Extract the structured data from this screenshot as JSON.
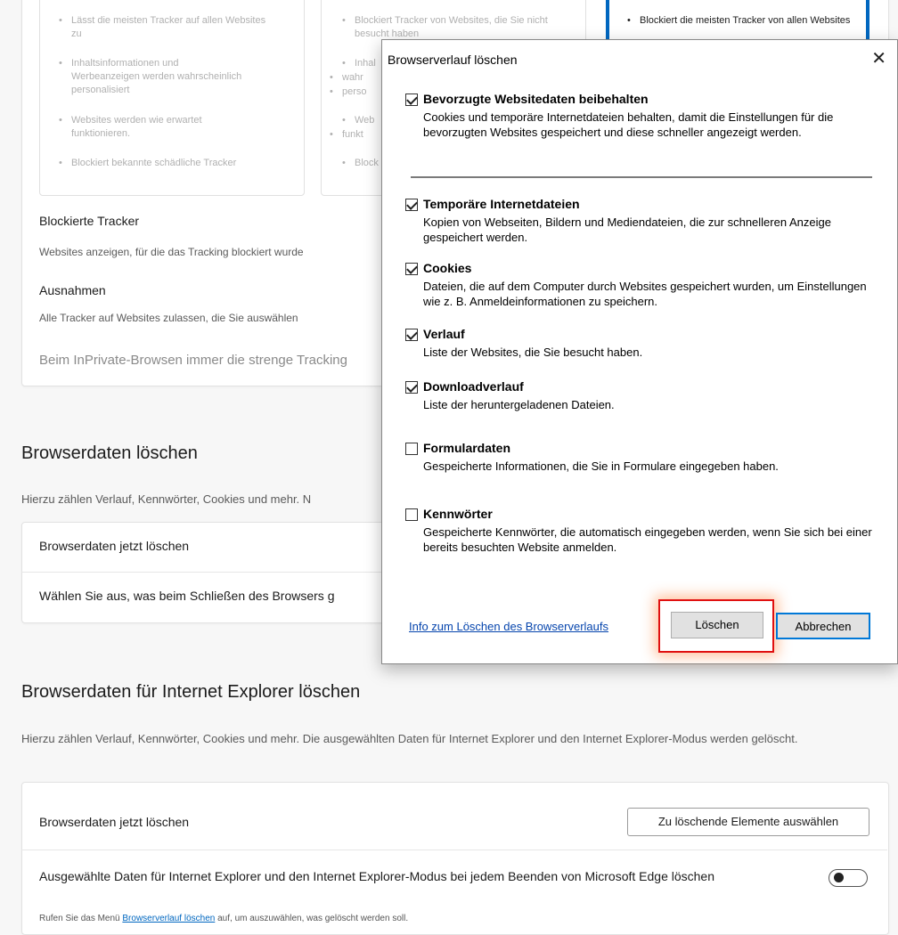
{
  "tracking": {
    "col1_bullets": [
      "Lässt die meisten Tracker auf allen Websites zu",
      "Inhaltsinformationen und Werbeanzeigen werden wahrscheinlich personalisiert",
      "Websites werden wie erwartet funktionieren.",
      "Blockiert bekannte schädliche Tracker"
    ],
    "col2_bullets": [
      "Blockiert Tracker von Websites, die Sie nicht besucht haben",
      "Inhal",
      "wahr",
      "perso",
      "Web",
      "funkt",
      "Block"
    ],
    "col3_bullets": [
      "Blockiert die meisten Tracker von allen Websites"
    ],
    "blocked_title": "Blockierte Tracker",
    "blocked_desc": "Websites anzeigen, für die das Tracking blockiert wurde",
    "exceptions_title": "Ausnahmen",
    "exceptions_desc": "Alle Tracker auf Websites zulassen, die Sie auswählen",
    "inprivate_label": "Beim InPrivate-Browsen immer die strenge Tracking"
  },
  "clear_data": {
    "title": "Browserdaten löschen",
    "desc": "Hierzu zählen Verlauf, Kennwörter, Cookies und mehr. N",
    "row1": "Browserdaten jetzt löschen",
    "row2": "Wählen Sie aus, was beim Schließen des Browsers g"
  },
  "ie_data": {
    "title": "Browserdaten für Internet Explorer löschen",
    "desc": "Hierzu zählen Verlauf, Kennwörter, Cookies und mehr. Die ausgewählten Daten für Internet Explorer und den Internet Explorer-Modus werden gelöscht.",
    "row1": "Browserdaten jetzt löschen",
    "choose_button": "Zu löschende Elemente auswählen",
    "toggle_label": "Ausgewählte Daten für Internet Explorer und den Internet Explorer-Modus bei jedem Beenden von Microsoft Edge löschen",
    "hint_prefix": "Rufen Sie das Menü ",
    "hint_link": "Browserverlauf löschen",
    "hint_suffix": " auf, um auszuwählen, was gelöscht werden soll."
  },
  "dialog": {
    "title": "Browserverlauf löschen",
    "close_glyph": "✕",
    "options": [
      {
        "title": "Bevorzugte Websitedaten beibehalten",
        "desc": "Cookies und temporäre Internetdateien behalten, damit die Einstellungen für die bevorzugten Websites gespeichert und diese schneller angezeigt werden.",
        "checked": true
      },
      {
        "title": "Temporäre Internetdateien",
        "desc": "Kopien von Webseiten, Bildern und Mediendateien, die zur schnelleren Anzeige gespeichert werden.",
        "checked": true
      },
      {
        "title": "Cookies",
        "desc": "Dateien, die auf dem Computer durch Websites gespeichert wurden, um Einstellungen wie z. B. Anmeldeinformationen zu speichern.",
        "checked": true
      },
      {
        "title": "Verlauf",
        "desc": "Liste der Websites, die Sie besucht haben.",
        "checked": true
      },
      {
        "title": "Downloadverlauf",
        "desc": "Liste der heruntergeladenen Dateien.",
        "checked": true
      },
      {
        "title": "Formulardaten",
        "desc": "Gespeicherte Informationen, die Sie in Formulare eingegeben haben.",
        "checked": false
      },
      {
        "title": "Kennwörter",
        "desc": "Gespeicherte Kennwörter, die automatisch eingegeben werden, wenn Sie sich bei einer bereits besuchten Website anmelden.",
        "checked": false
      }
    ],
    "info_link": "Info zum Löschen des Browserverlaufs",
    "delete_button": "Löschen",
    "cancel_button": "Abbrechen"
  }
}
